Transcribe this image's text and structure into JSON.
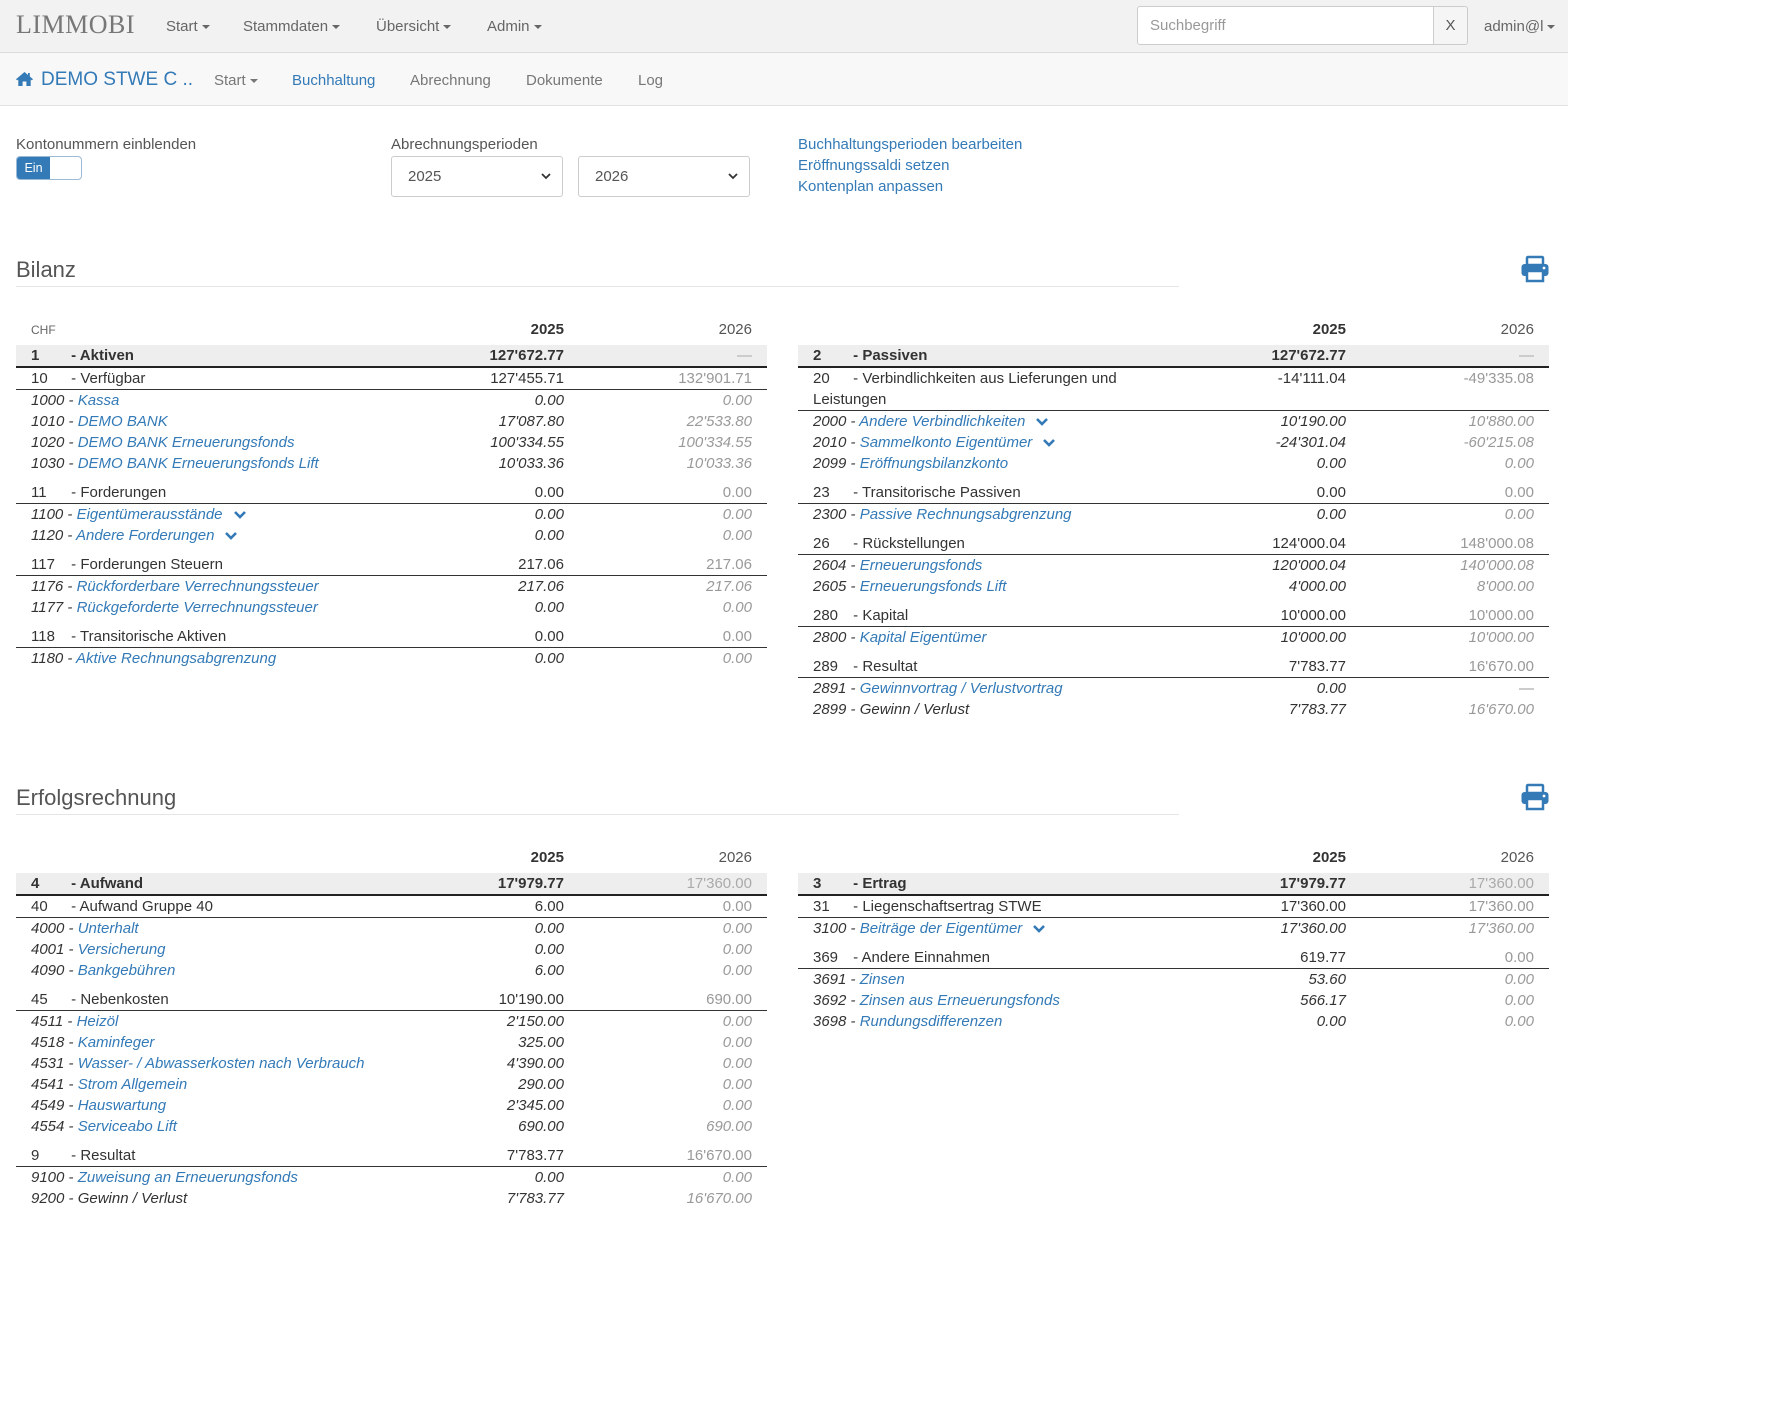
{
  "topbar": {
    "brand": "LIMMOBI",
    "nav": [
      {
        "label": "Start",
        "dropdown": true
      },
      {
        "label": "Stammdaten",
        "dropdown": true
      },
      {
        "label": "Übersicht",
        "dropdown": true
      },
      {
        "label": "Admin",
        "dropdown": true
      }
    ],
    "search_placeholder": "Suchbegriff",
    "search_value": "",
    "search_clear": "X",
    "user": "admin@l"
  },
  "subbar": {
    "property": "DEMO STWE C ..",
    "nav": [
      {
        "label": "Start",
        "dropdown": true,
        "active": false
      },
      {
        "label": "Buchhaltung",
        "dropdown": false,
        "active": true
      },
      {
        "label": "Abrechnung",
        "dropdown": false,
        "active": false
      },
      {
        "label": "Dokumente",
        "dropdown": false,
        "active": false
      },
      {
        "label": "Log",
        "dropdown": false,
        "active": false
      }
    ]
  },
  "controls": {
    "kontonummern_label": "Kontonummern einblenden",
    "toggle_on": "Ein",
    "perioden_label": "Abrechnungsperioden",
    "period1": "2025",
    "period2": "2026",
    "links": [
      "Buchhaltungsperioden bearbeiten",
      "Eröffnungssaldi setzen",
      "Kontenplan anpassen"
    ]
  },
  "colors": {
    "accent": "#337ab7",
    "header_bg": "#eeeeee"
  },
  "icons": {
    "home": "home-icon",
    "print": "print-icon",
    "dropdown": "chevron-down-icon"
  },
  "bilanz": {
    "title": "Bilanz",
    "currency": "CHF",
    "col1": "2025",
    "col2": "2026",
    "left": {
      "main": {
        "nr": "1",
        "name": "Aktiven",
        "v1": "127'672.77",
        "v2": "—"
      },
      "groups": [
        {
          "nr": "10",
          "name": "Verfügbar",
          "v1": "127'455.71",
          "v2": "132'901.71",
          "items": [
            {
              "nr": "1000",
              "name": "Kassa",
              "link": true,
              "v1": "0.00",
              "v2": "0.00"
            },
            {
              "nr": "1010",
              "name": "DEMO BANK",
              "link": true,
              "v1": "17'087.80",
              "v2": "22'533.80"
            },
            {
              "nr": "1020",
              "name": "DEMO BANK Erneuerungsfonds",
              "link": true,
              "v1": "100'334.55",
              "v2": "100'334.55"
            },
            {
              "nr": "1030",
              "name": "DEMO BANK Erneuerungsfonds Lift",
              "link": true,
              "v1": "10'033.36",
              "v2": "10'033.36"
            }
          ]
        },
        {
          "nr": "11",
          "name": "Forderungen",
          "v1": "0.00",
          "v2": "0.00",
          "items": [
            {
              "nr": "1100",
              "name": "Eigentümerausstände",
              "link": true,
              "dropdown": true,
              "v1": "0.00",
              "v2": "0.00"
            },
            {
              "nr": "1120",
              "name": "Andere Forderungen",
              "link": true,
              "dropdown": true,
              "v1": "0.00",
              "v2": "0.00"
            }
          ]
        },
        {
          "nr": "117",
          "name": "Forderungen Steuern",
          "v1": "217.06",
          "v2": "217.06",
          "items": [
            {
              "nr": "1176",
              "name": "Rückforderbare Verrechnungssteuer",
              "link": true,
              "v1": "217.06",
              "v2": "217.06"
            },
            {
              "nr": "1177",
              "name": "Rückgeforderte Verrechnungssteuer",
              "link": true,
              "v1": "0.00",
              "v2": "0.00"
            }
          ]
        },
        {
          "nr": "118",
          "name": "Transitorische Aktiven",
          "v1": "0.00",
          "v2": "0.00",
          "items": [
            {
              "nr": "1180",
              "name": "Aktive Rechnungsabgrenzung",
              "link": true,
              "v1": "0.00",
              "v2": "0.00"
            }
          ]
        }
      ]
    },
    "right": {
      "main": {
        "nr": "2",
        "name": "Passiven",
        "v1": "127'672.77",
        "v2": "—"
      },
      "groups": [
        {
          "nr": "20",
          "name": "Verbindlichkeiten aus Lieferungen und Leistungen",
          "tall": true,
          "v1": "-14'111.04",
          "v2": "-49'335.08",
          "items": [
            {
              "nr": "2000",
              "name": "Andere Verbindlichkeiten",
              "link": true,
              "dropdown": true,
              "v1": "10'190.00",
              "v2": "10'880.00"
            },
            {
              "nr": "2010",
              "name": "Sammelkonto Eigentümer",
              "link": true,
              "dropdown": true,
              "v1": "-24'301.04",
              "v2": "-60'215.08"
            },
            {
              "nr": "2099",
              "name": "Eröffnungsbilanzkonto",
              "link": true,
              "v1": "0.00",
              "v2": "0.00"
            }
          ]
        },
        {
          "nr": "23",
          "name": "Transitorische Passiven",
          "v1": "0.00",
          "v2": "0.00",
          "items": [
            {
              "nr": "2300",
              "name": "Passive Rechnungsabgrenzung",
              "link": true,
              "v1": "0.00",
              "v2": "0.00"
            }
          ]
        },
        {
          "nr": "26",
          "name": "Rückstellungen",
          "v1": "124'000.04",
          "v2": "148'000.08",
          "items": [
            {
              "nr": "2604",
              "name": "Erneuerungsfonds",
              "link": true,
              "v1": "120'000.04",
              "v2": "140'000.08"
            },
            {
              "nr": "2605",
              "name": "Erneuerungsfonds Lift",
              "link": true,
              "v1": "4'000.00",
              "v2": "8'000.00"
            }
          ]
        },
        {
          "nr": "280",
          "name": "Kapital",
          "v1": "10'000.00",
          "v2": "10'000.00",
          "items": [
            {
              "nr": "2800",
              "name": "Kapital Eigentümer",
              "link": true,
              "v1": "10'000.00",
              "v2": "10'000.00"
            }
          ]
        },
        {
          "nr": "289",
          "name": "Resultat",
          "v1": "7'783.77",
          "v2": "16'670.00",
          "items": [
            {
              "nr": "2891",
              "name": "Gewinnvortrag / Verlustvortrag",
              "link": true,
              "v1": "0.00",
              "v2": "—"
            },
            {
              "nr": "2899",
              "name": "Gewinn / Verlust",
              "link": false,
              "v1": "7'783.77",
              "v2": "16'670.00"
            }
          ]
        }
      ]
    }
  },
  "erfolgsrechnung": {
    "title": "Erfolgsrechnung",
    "col1": "2025",
    "col2": "2026",
    "left": {
      "main": {
        "nr": "4",
        "name": "Aufwand",
        "v1": "17'979.77",
        "v2": "17'360.00"
      },
      "groups": [
        {
          "nr": "40",
          "name": "Aufwand Gruppe 40",
          "v1": "6.00",
          "v2": "0.00",
          "items": [
            {
              "nr": "4000",
              "name": "Unterhalt",
              "link": true,
              "v1": "0.00",
              "v2": "0.00"
            },
            {
              "nr": "4001",
              "name": "Versicherung",
              "link": true,
              "v1": "0.00",
              "v2": "0.00"
            },
            {
              "nr": "4090",
              "name": "Bankgebühren",
              "link": true,
              "v1": "6.00",
              "v2": "0.00"
            }
          ]
        },
        {
          "nr": "45",
          "name": "Nebenkosten",
          "v1": "10'190.00",
          "v2": "690.00",
          "items": [
            {
              "nr": "4511",
              "name": "Heizöl",
              "link": true,
              "v1": "2'150.00",
              "v2": "0.00"
            },
            {
              "nr": "4518",
              "name": "Kaminfeger",
              "link": true,
              "v1": "325.00",
              "v2": "0.00"
            },
            {
              "nr": "4531",
              "name": "Wasser- / Abwasserkosten nach Verbrauch",
              "link": true,
              "v1": "4'390.00",
              "v2": "0.00"
            },
            {
              "nr": "4541",
              "name": "Strom Allgemein",
              "link": true,
              "v1": "290.00",
              "v2": "0.00"
            },
            {
              "nr": "4549",
              "name": "Hauswartung",
              "link": true,
              "v1": "2'345.00",
              "v2": "0.00"
            },
            {
              "nr": "4554",
              "name": "Serviceabo Lift",
              "link": true,
              "v1": "690.00",
              "v2": "690.00"
            }
          ]
        },
        {
          "nr": "9",
          "name": "Resultat",
          "v1": "7'783.77",
          "v2": "16'670.00",
          "items": [
            {
              "nr": "9100",
              "name": "Zuweisung an Erneuerungsfonds",
              "link": true,
              "v1": "0.00",
              "v2": "0.00"
            },
            {
              "nr": "9200",
              "name": "Gewinn / Verlust",
              "link": false,
              "v1": "7'783.77",
              "v2": "16'670.00"
            }
          ]
        }
      ]
    },
    "right": {
      "main": {
        "nr": "3",
        "name": "Ertrag",
        "v1": "17'979.77",
        "v2": "17'360.00"
      },
      "groups": [
        {
          "nr": "31",
          "name": "Liegenschaftsertrag STWE",
          "v1": "17'360.00",
          "v2": "17'360.00",
          "items": [
            {
              "nr": "3100",
              "name": "Beiträge der Eigentümer",
              "link": true,
              "dropdown": true,
              "v1": "17'360.00",
              "v2": "17'360.00"
            }
          ]
        },
        {
          "nr": "369",
          "name": "Andere Einnahmen",
          "v1": "619.77",
          "v2": "0.00",
          "items": [
            {
              "nr": "3691",
              "name": "Zinsen",
              "link": true,
              "v1": "53.60",
              "v2": "0.00"
            },
            {
              "nr": "3692",
              "name": "Zinsen aus Erneuerungsfonds",
              "link": true,
              "v1": "566.17",
              "v2": "0.00"
            },
            {
              "nr": "3698",
              "name": "Rundungsdifferenzen",
              "link": true,
              "v1": "0.00",
              "v2": "0.00"
            }
          ]
        }
      ]
    }
  }
}
